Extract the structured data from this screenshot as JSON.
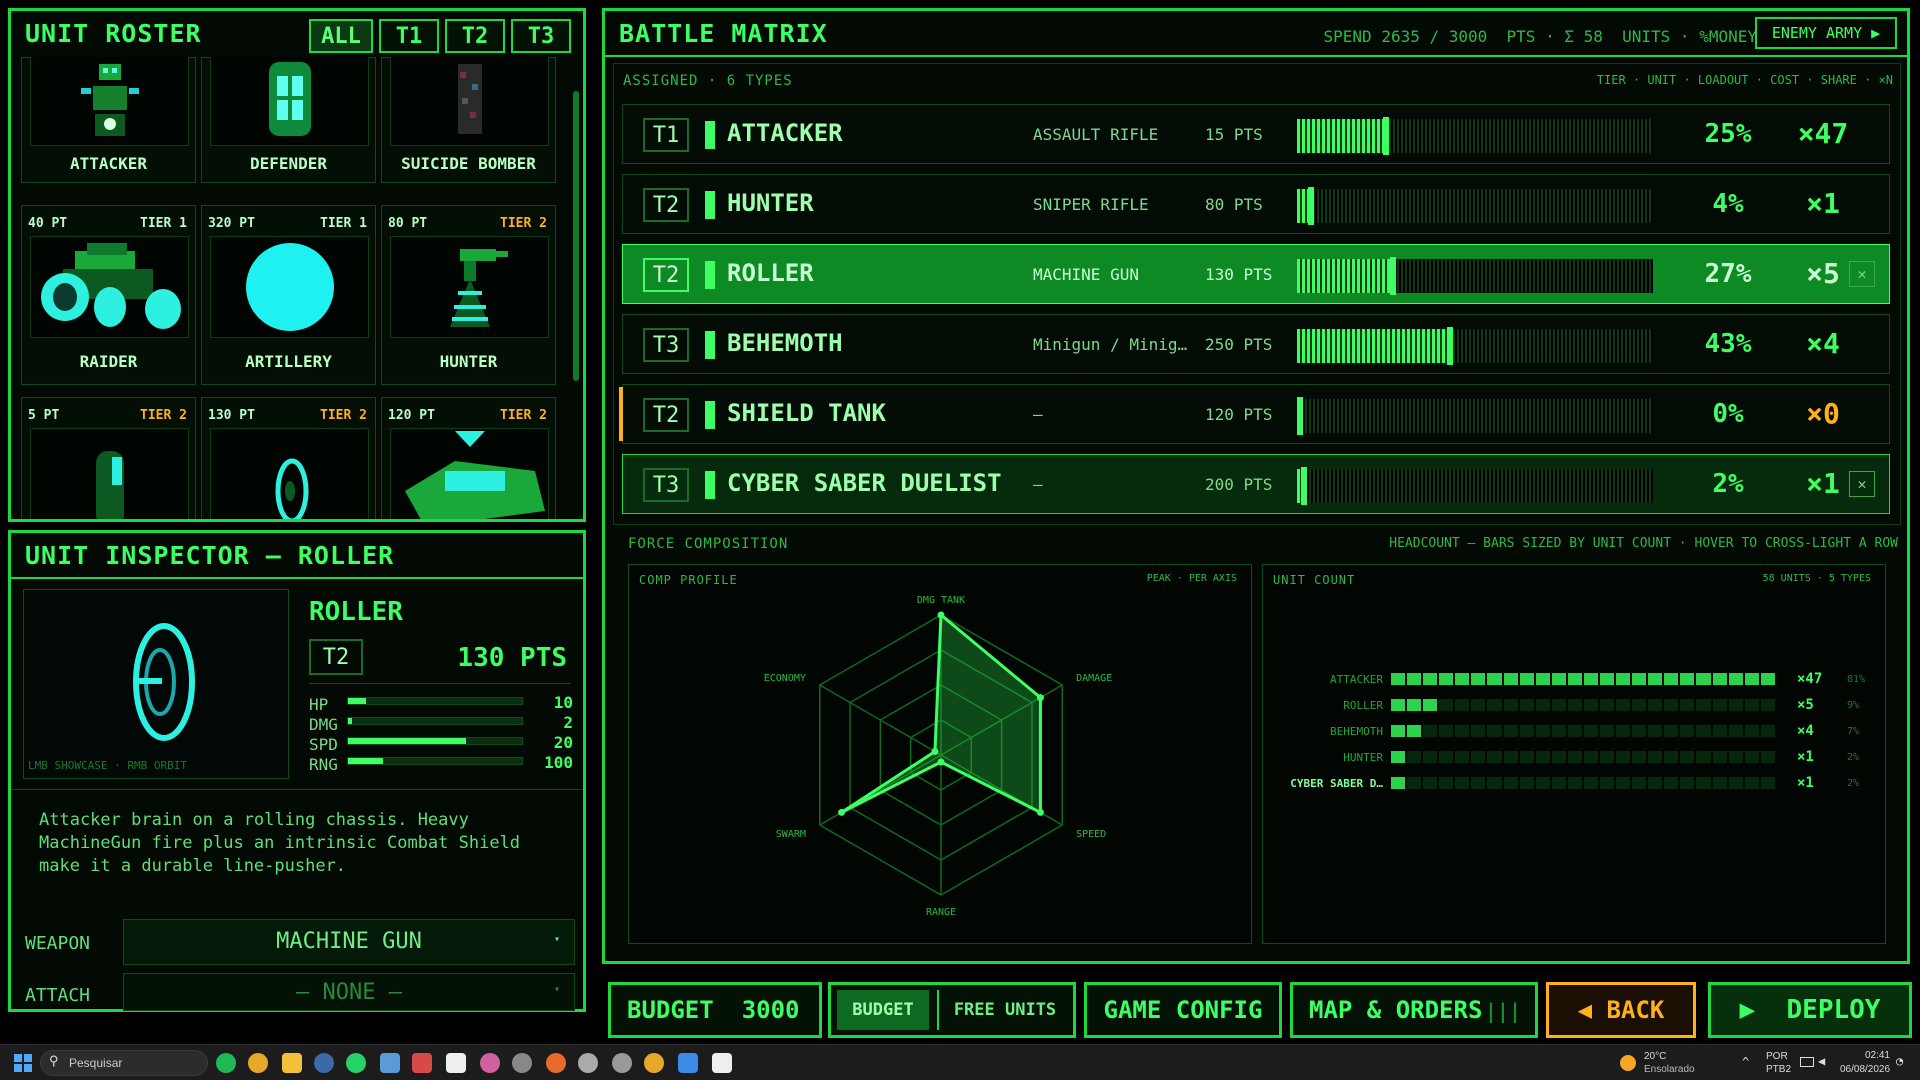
{
  "roster": {
    "title": "UNIT ROSTER",
    "filters": [
      "ALL",
      "T1",
      "T2",
      "T3"
    ],
    "top_cards": [
      {
        "name": "ATTACKER"
      },
      {
        "name": "DEFENDER"
      },
      {
        "name": "SUICIDE BOMBER"
      }
    ],
    "cards": [
      {
        "pts": "40 PT",
        "tier": "TIER 1",
        "tier_class": "t1",
        "name": "RAIDER"
      },
      {
        "pts": "320 PT",
        "tier": "TIER 1",
        "tier_class": "t1",
        "name": "ARTILLERY"
      },
      {
        "pts": "80 PT",
        "tier": "TIER 2",
        "tier_class": "t2",
        "name": "HUNTER"
      },
      {
        "pts": "5 PT",
        "tier": "TIER 2",
        "tier_class": "t2",
        "name": ""
      },
      {
        "pts": "130 PT",
        "tier": "TIER 2",
        "tier_class": "t2",
        "name": ""
      },
      {
        "pts": "120 PT",
        "tier": "TIER 2",
        "tier_class": "t2",
        "name": ""
      }
    ]
  },
  "inspector": {
    "title": "UNIT INSPECTOR — ROLLER",
    "unit_name": "ROLLER",
    "tier": "T2",
    "points": "130 PTS",
    "hint": "LMB SHOWCASE · RMB ORBIT",
    "stats": [
      {
        "label": "HP",
        "value": "10",
        "fill": 0.1
      },
      {
        "label": "DMG",
        "value": "2",
        "fill": 0.02
      },
      {
        "label": "SPD",
        "value": "20",
        "fill": 0.67
      },
      {
        "label": "RNG",
        "value": "100",
        "fill": 0.2
      }
    ],
    "description_lines": [
      "Attacker brain on a rolling chassis. Heavy",
      "MachineGun fire plus an intrinsic Combat Shield",
      "make it a durable line-pusher."
    ],
    "weapon_label": "WEAPON",
    "weapon_value": "MACHINE GUN",
    "attach_label": "ATTACH",
    "attach_value": "— NONE —"
  },
  "matrix": {
    "title": "BATTLE MATRIX",
    "summary": "SPEND 2635 / 3000  PTS · Σ 58  UNITS · %MONEY",
    "enemy_button": "ENEMY ARMY ▶",
    "assigned_label": "ASSIGNED · 6 TYPES",
    "columns_hint": "TIER · UNIT · LOADOUT · COST · SHARE · ×N",
    "rows": [
      {
        "tier": "T1",
        "name": "ATTACKER",
        "loadout": "ASSAULT RIFLE",
        "cost": "15 PTS",
        "share_pct": 25,
        "share": "25%",
        "count": "×47",
        "state": "normal"
      },
      {
        "tier": "T2",
        "name": "HUNTER",
        "loadout": "SNIPER RIFLE",
        "cost": "80 PTS",
        "share_pct": 4,
        "share": "4%",
        "count": "×1",
        "state": "normal"
      },
      {
        "tier": "T2",
        "name": "ROLLER",
        "loadout": "MACHINE GUN",
        "cost": "130 PTS",
        "share_pct": 27,
        "share": "27%",
        "count": "×5",
        "state": "selected"
      },
      {
        "tier": "T3",
        "name": "BEHEMOTH",
        "loadout": "Minigun / Minig…",
        "cost": "250 PTS",
        "share_pct": 43,
        "share": "43%",
        "count": "×4",
        "state": "normal"
      },
      {
        "tier": "T2",
        "name": "SHIELD TANK",
        "loadout": "—",
        "cost": "120 PTS",
        "share_pct": 0,
        "share": "0%",
        "count": "×0",
        "state": "warn"
      },
      {
        "tier": "T3",
        "name": "CYBER SABER DUELIST",
        "loadout": "—",
        "cost": "200 PTS",
        "share_pct": 2,
        "share": "2%",
        "count": "×1",
        "state": "highlight"
      }
    ],
    "force_label": "FORCE COMPOSITION",
    "force_hint": "HEADCOUNT — BARS SIZED BY UNIT COUNT · HOVER TO CROSS-LIGHT A ROW",
    "comp_profile": {
      "title": "COMP PROFILE",
      "hint": "PEAK · PER AXIS",
      "axes": [
        "DMG TANK",
        "DAMAGE",
        "SPEED",
        "RANGE",
        "SWARM",
        "ECONOMY"
      ],
      "values": [
        1.0,
        0.82,
        0.82,
        0.05,
        0.82,
        0.05
      ]
    },
    "unit_count": {
      "title": "UNIT COUNT",
      "hint": "58 UNITS · 5 TYPES",
      "rows": [
        {
          "label": "ATTACKER",
          "count": "×47",
          "pct": "81%",
          "cells": 24
        },
        {
          "label": "ROLLER",
          "count": "×5",
          "pct": "9%",
          "cells": 3
        },
        {
          "label": "BEHEMOTH",
          "count": "×4",
          "pct": "7%",
          "cells": 2
        },
        {
          "label": "HUNTER",
          "count": "×1",
          "pct": "2%",
          "cells": 1
        },
        {
          "label": "CYBER SABER D…",
          "count": "×1",
          "pct": "2%",
          "cells": 1
        }
      ]
    }
  },
  "bottom": {
    "budget_label": "BUDGET",
    "budget_value": "3000",
    "mode_budget": "BUDGET",
    "mode_free": "FREE UNITS",
    "game_config": "GAME CONFIG",
    "map_orders": "MAP & ORDERS",
    "back": "◀ BACK",
    "deploy": "▶  DEPLOY"
  },
  "taskbar": {
    "search": "Pesquisar",
    "weather_temp": "20°C",
    "weather_text": "Ensolarado",
    "lang_top": "POR",
    "lang_bottom": "PTB2",
    "time": "02:41",
    "date": "06/08/2026"
  }
}
